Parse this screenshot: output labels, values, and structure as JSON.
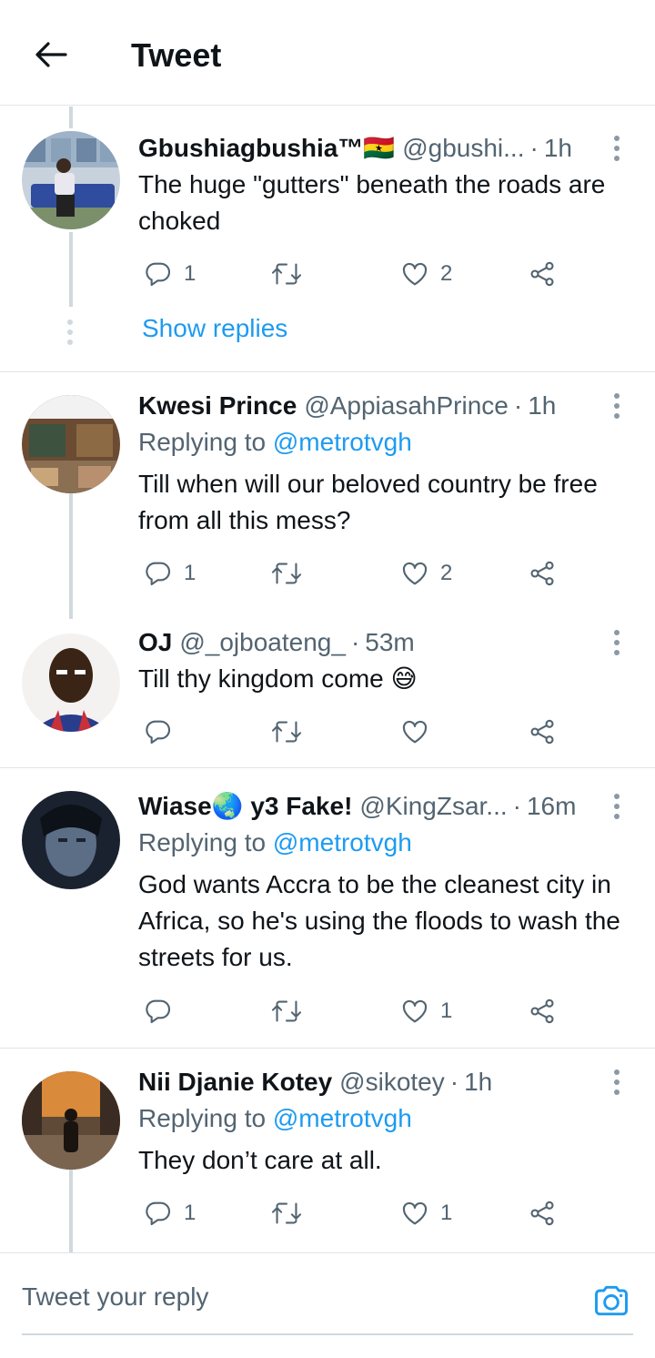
{
  "header": {
    "title": "Tweet"
  },
  "tweets": [
    {
      "name": "Gbushiagbushia™🇬🇭",
      "handle": "@gbushi...",
      "time": "1h",
      "text": "The huge \"gutters\" beneath the roads are choked",
      "reply_count": "1",
      "like_count": "2",
      "show_replies": "Show replies"
    },
    {
      "name": "Kwesi Prince",
      "handle": "@AppiasahPrince",
      "time": "1h",
      "replying_prefix": "Replying to",
      "replying_to": "@metrotvgh",
      "text": "Till when will our beloved country be free from all this mess?",
      "reply_count": "1",
      "like_count": "2"
    },
    {
      "name": "OJ",
      "handle": "@_ojboateng_",
      "time": "53m",
      "text": "Till thy kingdom come 😅"
    },
    {
      "name": "Wiase🌏 y3 Fake!",
      "handle": "@KingZsar...",
      "time": "16m",
      "replying_prefix": "Replying to",
      "replying_to": "@metrotvgh",
      "text": "God wants Accra to be the cleanest city in Africa, so he's using the floods to wash the streets for us.",
      "like_count": "1"
    },
    {
      "name": "Nii Djanie Kotey",
      "handle": "@sikotey",
      "time": "1h",
      "replying_prefix": "Replying to",
      "replying_to": "@metrotvgh",
      "text": "They don’t care at all.",
      "reply_count": "1",
      "like_count": "1"
    }
  ],
  "compose": {
    "placeholder": "Tweet your reply"
  },
  "colors": {
    "link": "#1d9bf0",
    "secondary": "#536471",
    "divider": "#e1e5e8"
  },
  "icons": [
    "back-arrow-icon",
    "more-icon",
    "reply-icon",
    "retweet-icon",
    "like-icon",
    "share-icon",
    "camera-icon"
  ]
}
